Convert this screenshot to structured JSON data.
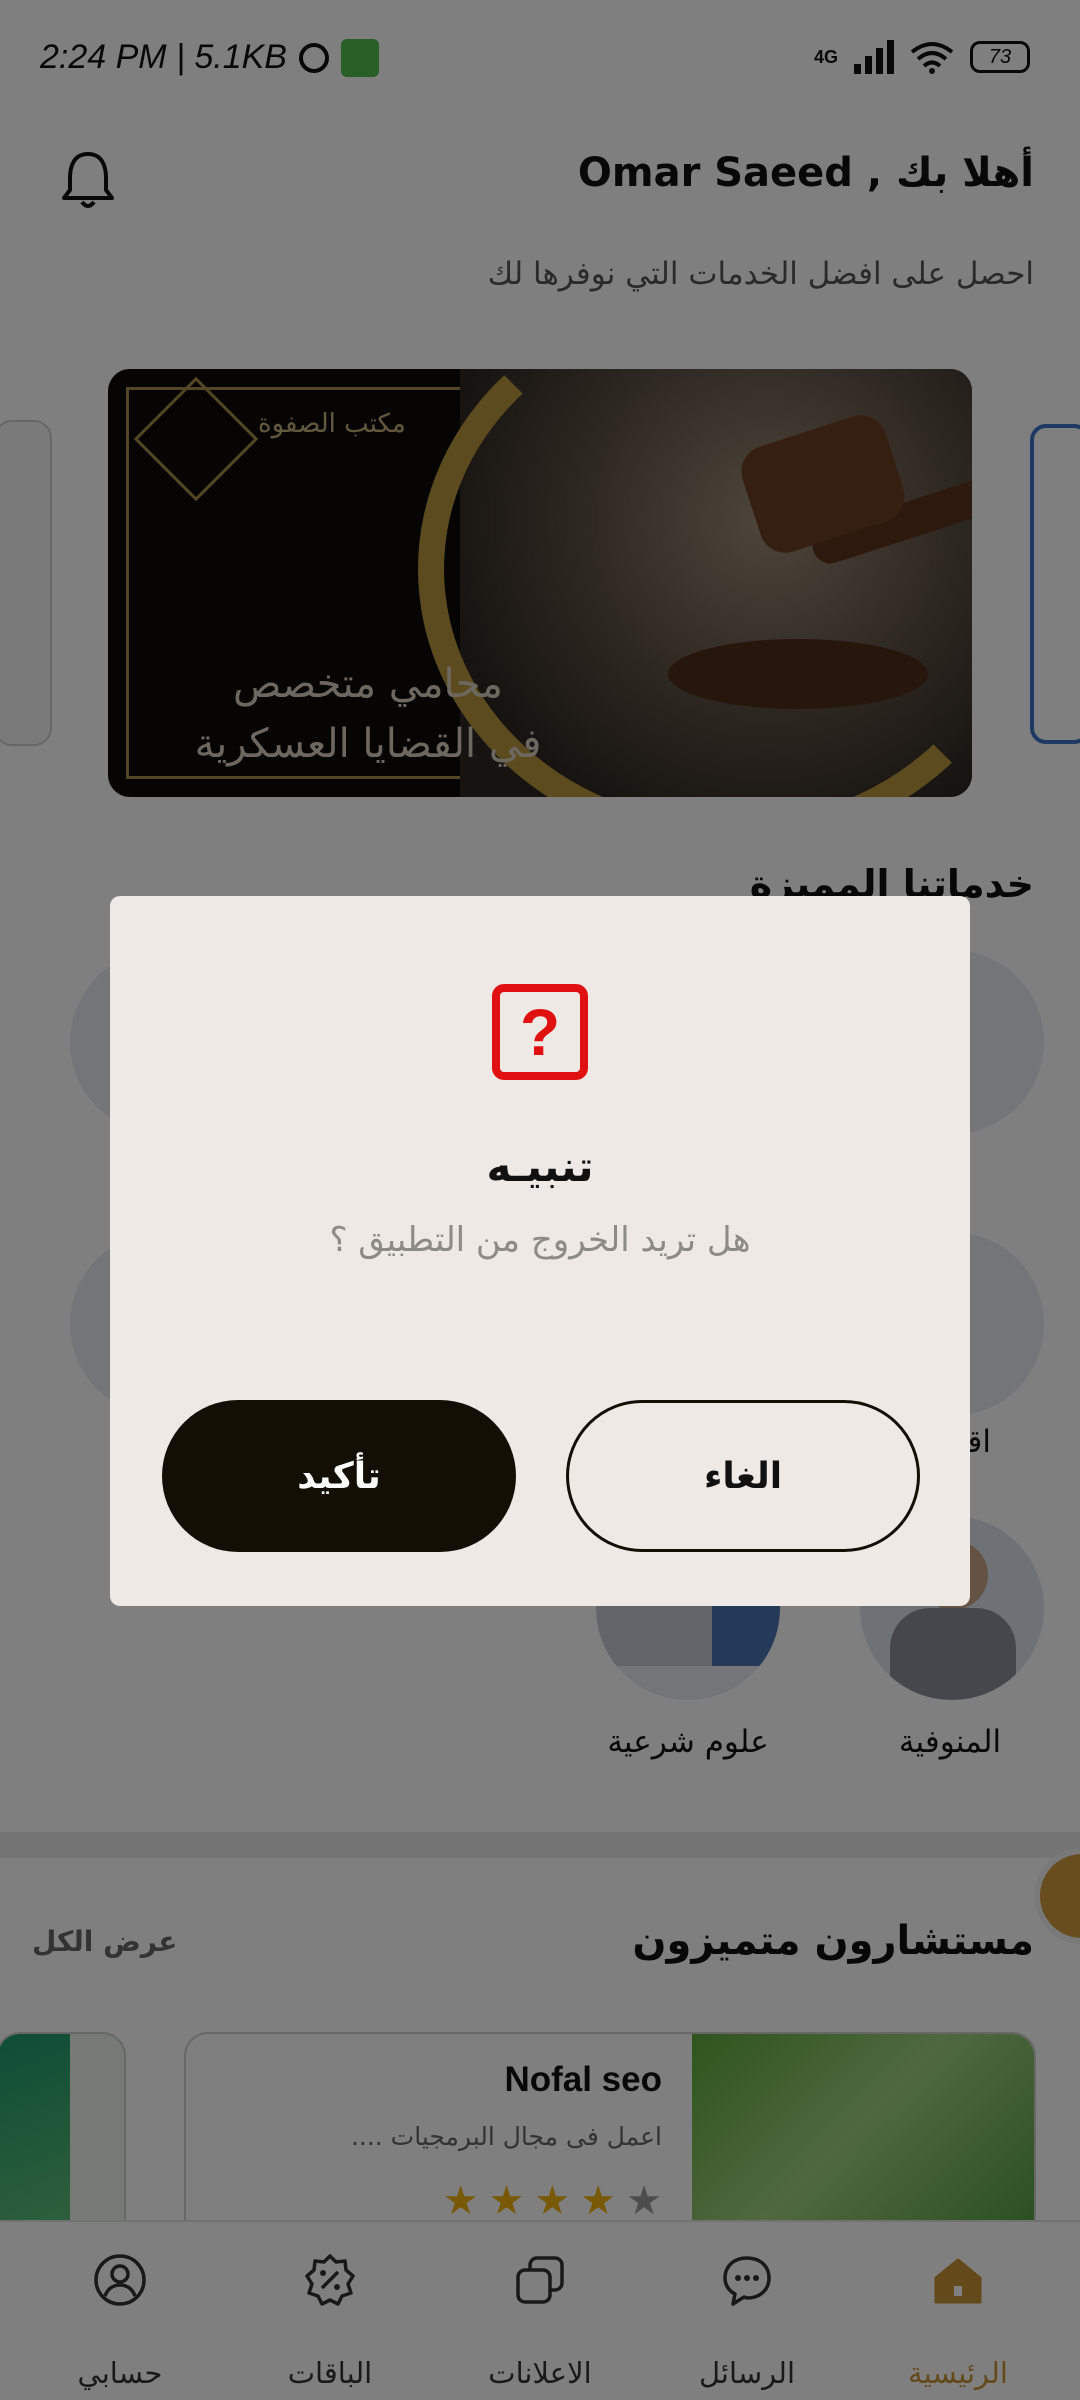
{
  "status_bar": {
    "time_data": "2:24 PM | 5.1KB",
    "network": "4G",
    "battery": "73"
  },
  "header": {
    "greeting": "أهلا بك , Omar Saeed",
    "subtitle": "احصل على افضل الخدمات التي نوفرها لك"
  },
  "banner": {
    "logo_text": "مكتب الصفوة",
    "line1": "محامي متخصص",
    "line2": "في القضايا العسكرية"
  },
  "services": {
    "title": "خدماتنا المميزة",
    "items": [
      {
        "label": "المنوفية"
      },
      {
        "label": "علوم شرعية"
      },
      {
        "label": "اقتـ"
      }
    ]
  },
  "consultants": {
    "title": "مستشارون متميزون",
    "view_all": "عرض الكل",
    "cards": [
      {
        "name": "Nofal seo",
        "description": "اعمل فى مجال البرمجيات ....",
        "rating": 4,
        "rating_max": 5
      }
    ]
  },
  "bottom_nav": {
    "items": [
      {
        "label": "الرئيسية",
        "icon": "home-icon",
        "active": true
      },
      {
        "label": "الرسائل",
        "icon": "chat-icon",
        "active": false
      },
      {
        "label": "الاعلانات",
        "icon": "ads-icon",
        "active": false
      },
      {
        "label": "الباقات",
        "icon": "packages-icon",
        "active": false
      },
      {
        "label": "حسابي",
        "icon": "account-icon",
        "active": false
      }
    ]
  },
  "dialog": {
    "icon": "question-icon",
    "title": "تنبيـه",
    "message": "هل تريد الخروج من التطبيق ؟",
    "confirm_label": "تأكيد",
    "cancel_label": "الغاء"
  },
  "colors": {
    "accent": "#c89436",
    "dialog_bg": "#efe9e5",
    "confirm_bg": "#140f05",
    "question_icon": "#e01010"
  }
}
